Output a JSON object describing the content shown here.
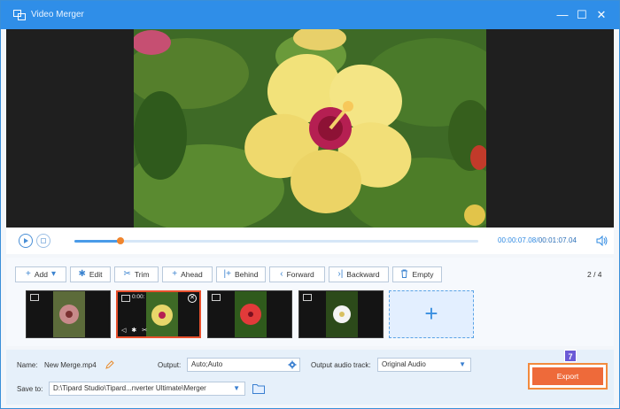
{
  "window": {
    "title": "Video Merger",
    "controls": {
      "minimize": "—",
      "maximize": "☐",
      "close": "✕"
    }
  },
  "player": {
    "progress_fraction": 0.115,
    "current_time": "00:00:07.08",
    "separator": "/",
    "total_time": "00:01:07.04"
  },
  "toolbar": {
    "buttons": [
      {
        "name": "add",
        "label": "Add",
        "icon": "+"
      },
      {
        "name": "edit",
        "label": "Edit",
        "icon": "✱"
      },
      {
        "name": "trim",
        "label": "Trim",
        "icon": "✂"
      },
      {
        "name": "ahead",
        "label": "Ahead",
        "icon": "+"
      },
      {
        "name": "behind",
        "label": "Behind",
        "icon": "|+"
      },
      {
        "name": "forward",
        "label": "Forward",
        "icon": "‹"
      },
      {
        "name": "backward",
        "label": "Backward",
        "icon": "›|"
      },
      {
        "name": "empty",
        "label": "Empty",
        "icon": "🗑"
      }
    ],
    "pager": "2 / 4"
  },
  "clips": [
    {
      "label": "",
      "flower_color": "#c88a8a",
      "selected": false
    },
    {
      "label": "0:00:",
      "flower_color": "#e8d66a",
      "selected": true
    },
    {
      "label": "",
      "flower_color": "#e23a3a",
      "selected": false
    },
    {
      "label": "",
      "flower_color": "#f4f4f4",
      "selected": false
    }
  ],
  "add_clip": "+",
  "output": {
    "name_label": "Name:",
    "name_value": "New Merge.mp4",
    "output_label": "Output:",
    "output_value": "Auto;Auto",
    "audio_label": "Output audio track:",
    "audio_value": "Original Audio",
    "save_label": "Save to:",
    "save_value": "D:\\Tipard Studio\\Tipard...nverter Ultimate\\Merger"
  },
  "export": {
    "label": "Export",
    "step_badge": "7"
  },
  "colors": {
    "titlebar": "#2f8ee8",
    "accent": "#2e89e2",
    "export": "#ee6a3a",
    "selected_border": "#e8502d"
  }
}
